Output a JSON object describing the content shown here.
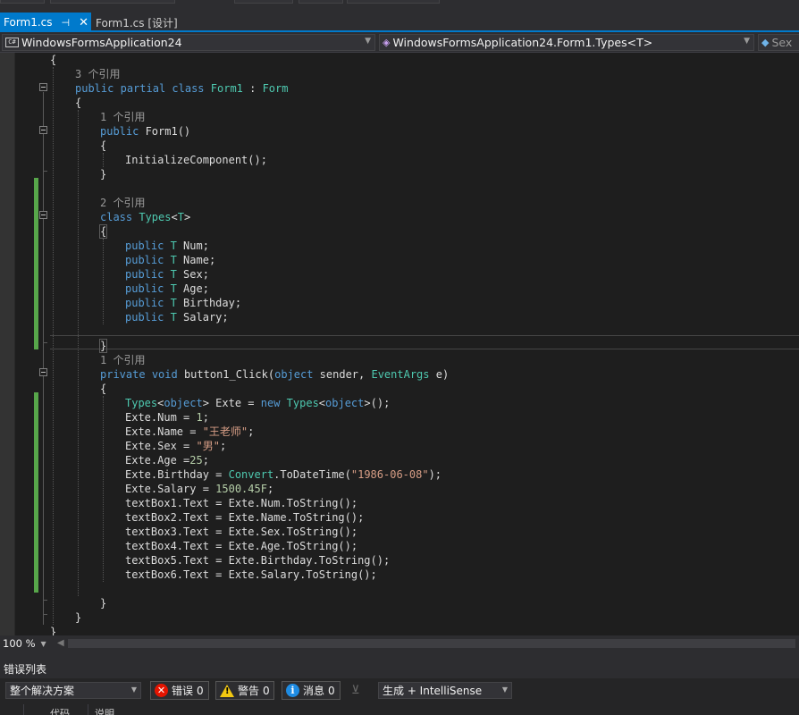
{
  "tabs": {
    "active_label": "Form1.cs",
    "active_pin": "⊣",
    "active_close": "✕",
    "inactive_label": "Form1.cs [设计]"
  },
  "navbar": {
    "project_icon": "C#",
    "project": "WindowsFormsApplication24",
    "type_scope": "WindowsFormsApplication24.Form1.Types<T>",
    "member": "Sex"
  },
  "code_lines": [
    {
      "segments": [
        [
          "p",
          "{"
        ]
      ]
    },
    {
      "segments": [
        [
          "l",
          "3 个引用"
        ]
      ]
    },
    {
      "segments": [
        [
          "k",
          "public"
        ],
        [
          "p",
          " "
        ],
        [
          "k",
          "partial"
        ],
        [
          "p",
          " "
        ],
        [
          "k",
          "class"
        ],
        [
          "p",
          " "
        ],
        [
          "t",
          "Form1"
        ],
        [
          "p",
          " : "
        ],
        [
          "t",
          "Form"
        ]
      ]
    },
    {
      "segments": [
        [
          "p",
          "{"
        ]
      ]
    },
    {
      "segments": [
        [
          "l",
          "1 个引用"
        ]
      ]
    },
    {
      "segments": [
        [
          "k",
          "public"
        ],
        [
          "p",
          " Form1()"
        ]
      ]
    },
    {
      "segments": [
        [
          "p",
          "{"
        ]
      ]
    },
    {
      "segments": [
        [
          "p",
          "InitializeComponent();"
        ]
      ]
    },
    {
      "segments": [
        [
          "p",
          "}"
        ]
      ]
    },
    {
      "segments": []
    },
    {
      "segments": [
        [
          "l",
          "2 个引用"
        ]
      ]
    },
    {
      "segments": [
        [
          "k",
          "class"
        ],
        [
          "p",
          " "
        ],
        [
          "t",
          "Types"
        ],
        [
          "p",
          "<"
        ],
        [
          "t",
          "T"
        ],
        [
          "p",
          ">"
        ]
      ]
    },
    {
      "segments": [
        [
          "b",
          "{"
        ]
      ]
    },
    {
      "segments": [
        [
          "k",
          "public"
        ],
        [
          "p",
          " "
        ],
        [
          "t",
          "T"
        ],
        [
          "p",
          " Num;"
        ]
      ]
    },
    {
      "segments": [
        [
          "k",
          "public"
        ],
        [
          "p",
          " "
        ],
        [
          "t",
          "T"
        ],
        [
          "p",
          " Name;"
        ]
      ]
    },
    {
      "segments": [
        [
          "k",
          "public"
        ],
        [
          "p",
          " "
        ],
        [
          "t",
          "T"
        ],
        [
          "p",
          " Sex;"
        ]
      ]
    },
    {
      "segments": [
        [
          "k",
          "public"
        ],
        [
          "p",
          " "
        ],
        [
          "t",
          "T"
        ],
        [
          "p",
          " Age;"
        ]
      ]
    },
    {
      "segments": [
        [
          "k",
          "public"
        ],
        [
          "p",
          " "
        ],
        [
          "t",
          "T"
        ],
        [
          "p",
          " Birthday;"
        ]
      ]
    },
    {
      "segments": [
        [
          "k",
          "public"
        ],
        [
          "p",
          " "
        ],
        [
          "t",
          "T"
        ],
        [
          "p",
          " Salary;"
        ]
      ]
    },
    {
      "segments": []
    },
    {
      "segments": [
        [
          "b",
          "}"
        ],
        [
          "c",
          ""
        ]
      ]
    },
    {
      "segments": [
        [
          "l",
          "1 个引用"
        ]
      ]
    },
    {
      "segments": [
        [
          "k",
          "private"
        ],
        [
          "p",
          " "
        ],
        [
          "k",
          "void"
        ],
        [
          "p",
          " button1_Click("
        ],
        [
          "k",
          "object"
        ],
        [
          "p",
          " sender, "
        ],
        [
          "t",
          "EventArgs"
        ],
        [
          "p",
          " e)"
        ]
      ]
    },
    {
      "segments": [
        [
          "p",
          "{"
        ]
      ]
    },
    {
      "segments": [
        [
          "t",
          "Types"
        ],
        [
          "p",
          "<"
        ],
        [
          "k",
          "object"
        ],
        [
          "p",
          "> Exte = "
        ],
        [
          "k",
          "new"
        ],
        [
          "p",
          " "
        ],
        [
          "t",
          "Types"
        ],
        [
          "p",
          "<"
        ],
        [
          "k",
          "object"
        ],
        [
          "p",
          ">();"
        ]
      ]
    },
    {
      "segments": [
        [
          "p",
          "Exte.Num = "
        ],
        [
          "n",
          "1"
        ],
        [
          "p",
          ";"
        ]
      ]
    },
    {
      "segments": [
        [
          "p",
          "Exte.Name = "
        ],
        [
          "s",
          "\"王老师\""
        ],
        [
          "p",
          ";"
        ]
      ]
    },
    {
      "segments": [
        [
          "p",
          "Exte.Sex = "
        ],
        [
          "s",
          "\"男\""
        ],
        [
          "p",
          ";"
        ]
      ]
    },
    {
      "segments": [
        [
          "p",
          "Exte.Age ="
        ],
        [
          "n",
          "25"
        ],
        [
          "p",
          ";"
        ]
      ]
    },
    {
      "segments": [
        [
          "p",
          "Exte.Birthday = "
        ],
        [
          "t",
          "Convert"
        ],
        [
          "p",
          ".ToDateTime("
        ],
        [
          "s",
          "\"1986-06-08\""
        ],
        [
          "p",
          ");"
        ]
      ]
    },
    {
      "segments": [
        [
          "p",
          "Exte.Salary = "
        ],
        [
          "n",
          "1500.45F"
        ],
        [
          "p",
          ";"
        ]
      ]
    },
    {
      "segments": [
        [
          "p",
          "textBox1.Text = Exte.Num.ToString();"
        ]
      ]
    },
    {
      "segments": [
        [
          "p",
          "textBox2.Text = Exte.Name.ToString();"
        ]
      ]
    },
    {
      "segments": [
        [
          "p",
          "textBox3.Text = Exte.Sex.ToString();"
        ]
      ]
    },
    {
      "segments": [
        [
          "p",
          "textBox4.Text = Exte.Age.ToString();"
        ]
      ]
    },
    {
      "segments": [
        [
          "p",
          "textBox5.Text = Exte.Birthday.ToString();"
        ]
      ]
    },
    {
      "segments": [
        [
          "p",
          "textBox6.Text = Exte.Salary.ToString();"
        ]
      ]
    },
    {
      "segments": []
    },
    {
      "segments": [
        [
          "p",
          "}"
        ]
      ]
    },
    {
      "segments": [
        [
          "p",
          "}"
        ]
      ]
    },
    {
      "segments": [
        [
          "p",
          "}"
        ]
      ]
    }
  ],
  "zoom": {
    "value": "100 %"
  },
  "error_list": {
    "title": "错误列表",
    "scope": "整个解决方案",
    "errors_label": "错误",
    "errors_count": "0",
    "warnings_label": "警告",
    "warnings_count": "0",
    "messages_label": "消息",
    "messages_count": "0",
    "build_filter": "生成 + IntelliSense",
    "col_code": "代码",
    "col_desc": "说明"
  },
  "colors": {
    "accent": "#007acc",
    "keyword": "#569cd6",
    "type": "#4ec9b0",
    "string": "#d69d85",
    "number": "#b5cea8",
    "codelens": "#999999",
    "change_bar": "#57a64a",
    "error": "#e51400",
    "warning": "#f2c811",
    "info": "#1e8ce3"
  }
}
